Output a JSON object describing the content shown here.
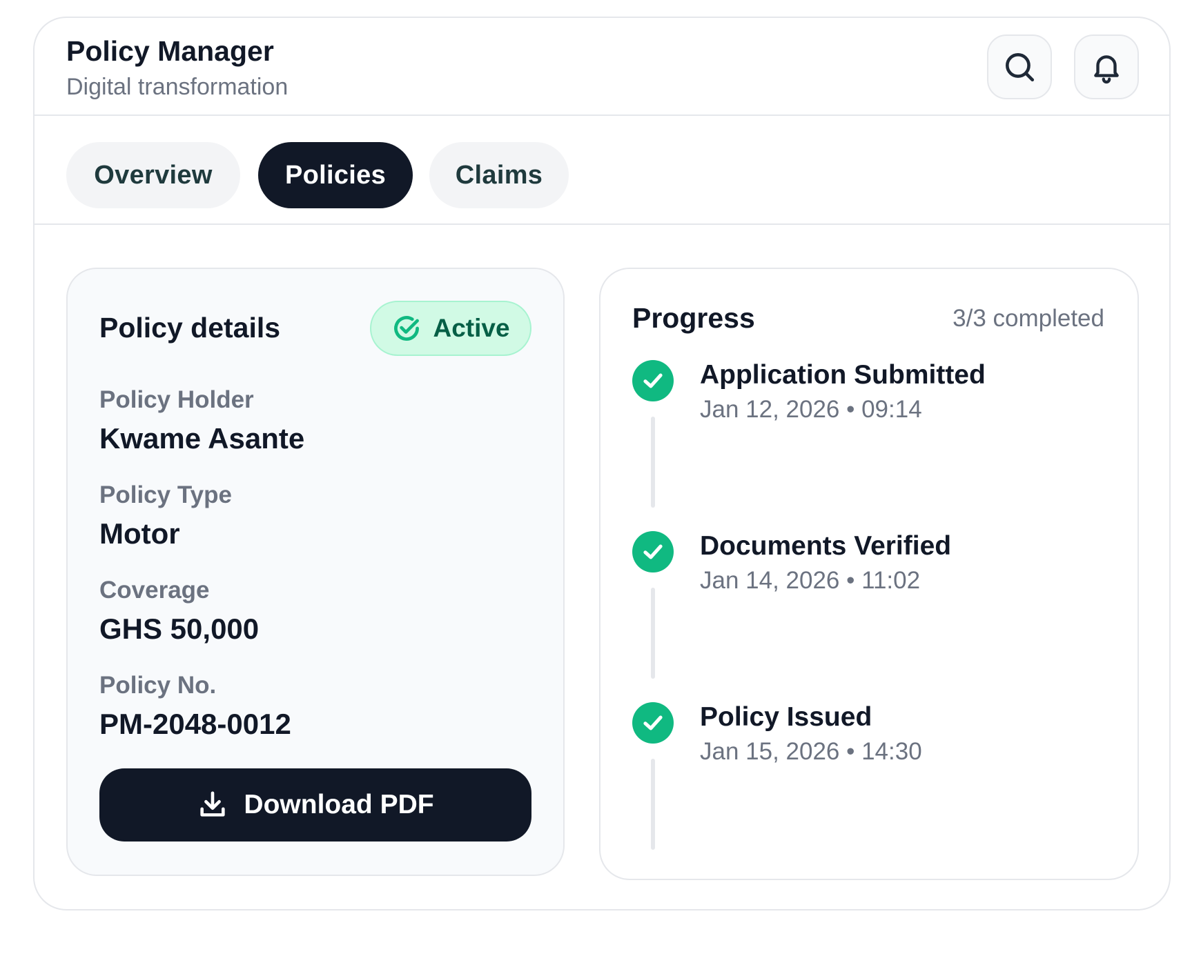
{
  "header": {
    "title": "Policy Manager",
    "subtitle": "Digital transformation",
    "search_icon": "search-icon",
    "bell_icon": "bell-icon"
  },
  "tabs": [
    {
      "label": "Overview",
      "active": false
    },
    {
      "label": "Policies",
      "active": true
    },
    {
      "label": "Claims",
      "active": false
    }
  ],
  "details": {
    "title": "Policy details",
    "status": "Active",
    "status_icon": "check-circle-icon",
    "fields": [
      {
        "label": "Policy Holder",
        "value": "Kwame Asante"
      },
      {
        "label": "Policy Type",
        "value": "Motor"
      },
      {
        "label": "Coverage",
        "value": "GHS 50,000"
      },
      {
        "label": "Policy No.",
        "value": "PM-2048-0012"
      }
    ],
    "download_label": "Download PDF",
    "download_icon": "download-icon"
  },
  "progress": {
    "title": "Progress",
    "count": "3/3 completed",
    "steps": [
      {
        "title": "Application Submitted",
        "time": "Jan 12, 2026 • 09:14",
        "done": true
      },
      {
        "title": "Documents Verified",
        "time": "Jan 14, 2026 • 11:02",
        "done": true
      },
      {
        "title": "Policy Issued",
        "time": "Jan 15, 2026 • 14:30",
        "done": true
      }
    ]
  },
  "colors": {
    "primary_dark": "#111827",
    "success": "#10b981",
    "success_bg": "#d1fae5",
    "muted_text": "#6b7280",
    "border": "#e5e7eb"
  }
}
